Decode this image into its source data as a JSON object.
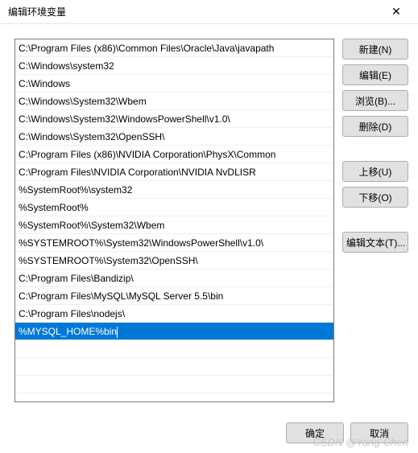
{
  "title": "编辑环境变量",
  "paths": [
    "C:\\Program Files (x86)\\Common Files\\Oracle\\Java\\javapath",
    "C:\\Windows\\system32",
    "C:\\Windows",
    "C:\\Windows\\System32\\Wbem",
    "C:\\Windows\\System32\\WindowsPowerShell\\v1.0\\",
    "C:\\Windows\\System32\\OpenSSH\\",
    "C:\\Program Files (x86)\\NVIDIA Corporation\\PhysX\\Common",
    "C:\\Program Files\\NVIDIA Corporation\\NVIDIA NvDLISR",
    "%SystemRoot%\\system32",
    "%SystemRoot%",
    "%SystemRoot%\\System32\\Wbem",
    "%SYSTEMROOT%\\System32\\WindowsPowerShell\\v1.0\\",
    "%SYSTEMROOT%\\System32\\OpenSSH\\",
    "C:\\Program Files\\Bandizip\\",
    "C:\\Program Files\\MySQL\\MySQL Server 5.5\\bin",
    "C:\\Program Files\\nodejs\\",
    "%MYSQL_HOME%bin"
  ],
  "selected_index": 16,
  "buttons": {
    "new": "新建(N)",
    "edit": "编辑(E)",
    "browse": "浏览(B)...",
    "delete": "删除(D)",
    "move_up": "上移(U)",
    "move_down": "下移(O)",
    "edit_text": "编辑文本(T)...",
    "ok": "确定",
    "cancel": "取消"
  },
  "watermark": "CSDN @Yang·Chen"
}
